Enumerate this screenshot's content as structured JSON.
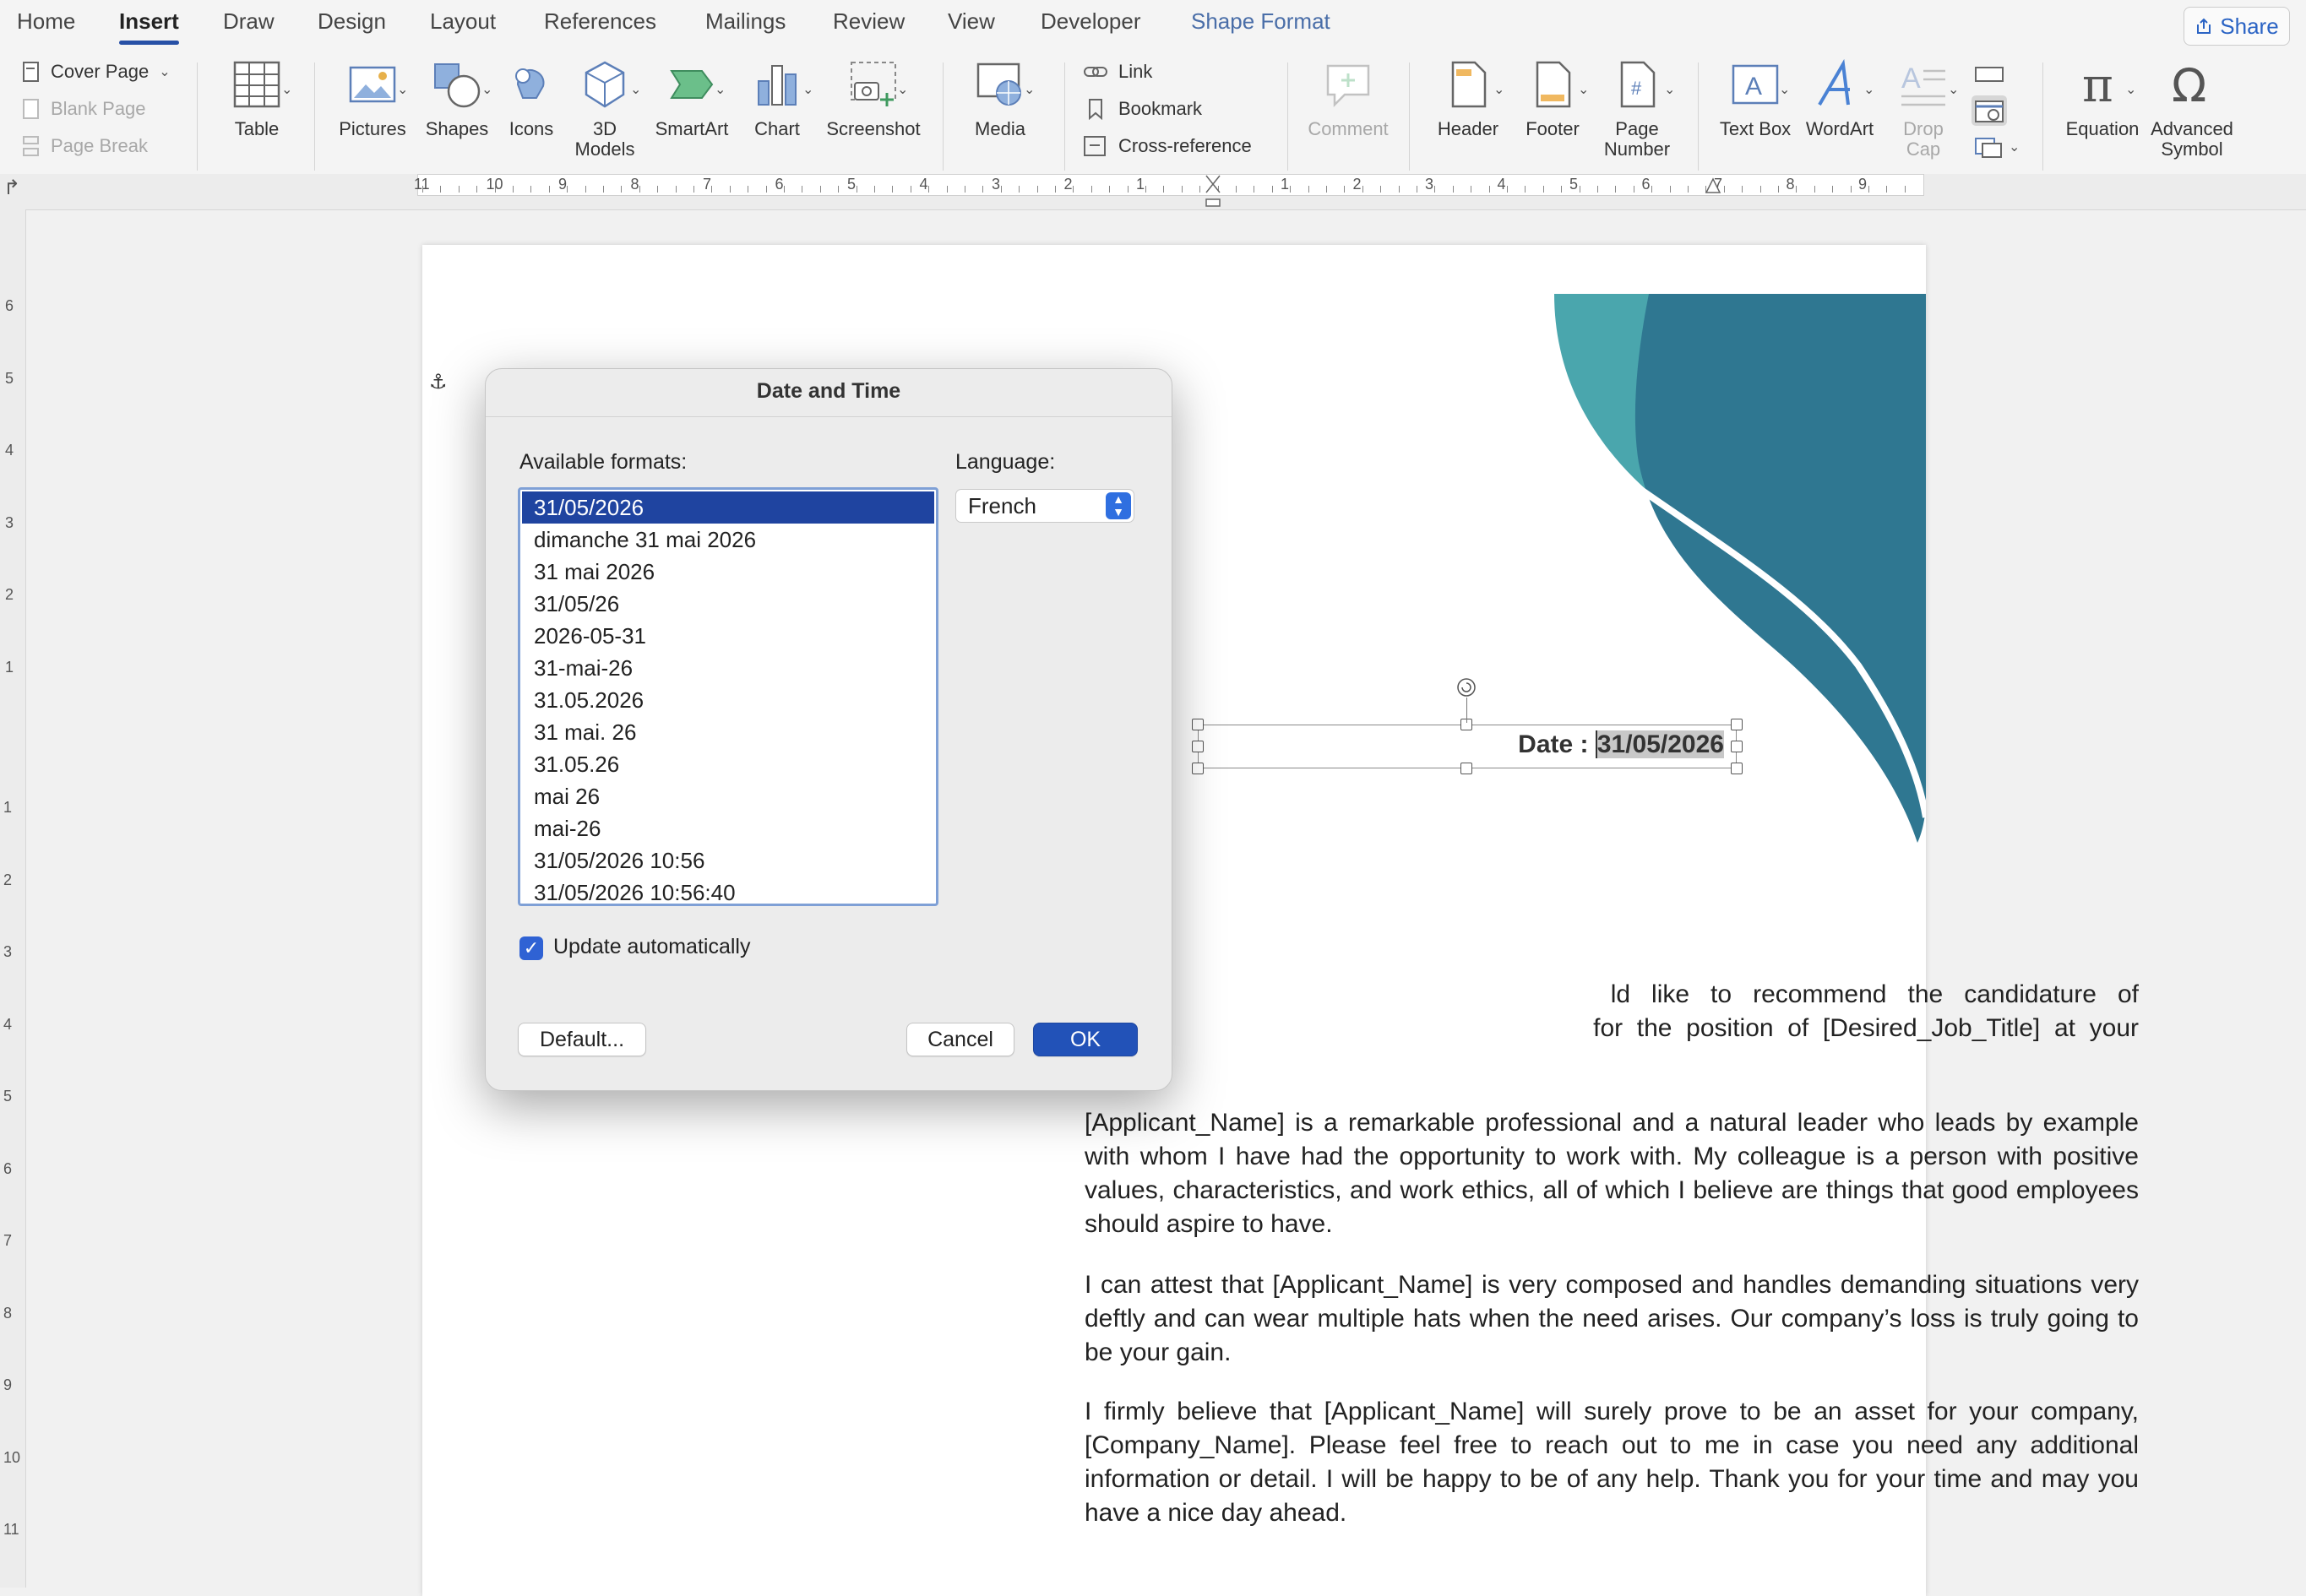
{
  "tabs": {
    "home": "Home",
    "insert": "Insert",
    "draw": "Draw",
    "design": "Design",
    "layout": "Layout",
    "references": "References",
    "mailings": "Mailings",
    "review": "Review",
    "view": "View",
    "developer": "Developer",
    "shape_format": "Shape Format"
  },
  "share_label": "Share",
  "ribbon": {
    "cover_page": "Cover Page",
    "blank_page": "Blank Page",
    "page_break": "Page Break",
    "table": "Table",
    "pictures": "Pictures",
    "shapes": "Shapes",
    "icons": "Icons",
    "models_3d_line1": "3D",
    "models_3d_line2": "Models",
    "smartart": "SmartArt",
    "chart": "Chart",
    "screenshot": "Screenshot",
    "media": "Media",
    "link": "Link",
    "bookmark": "Bookmark",
    "cross_reference": "Cross-reference",
    "comment": "Comment",
    "header": "Header",
    "footer": "Footer",
    "page_number_line1": "Page",
    "page_number_line2": "Number",
    "text_box": "Text Box",
    "wordart": "WordArt",
    "drop_cap_line1": "Drop",
    "drop_cap_line2": "Cap",
    "equation": "Equation",
    "advanced_symbol_line1": "Advanced",
    "advanced_symbol_line2": "Symbol"
  },
  "ruler": {
    "top_left": [
      "11",
      "10",
      "9",
      "8",
      "7",
      "6",
      "5",
      "4",
      "3",
      "2",
      "1"
    ],
    "top_right": [
      "1",
      "2",
      "3",
      "4",
      "5",
      "6",
      "7",
      "8",
      "9"
    ],
    "side_up": [
      "6",
      "5",
      "4",
      "3",
      "2",
      "1"
    ],
    "side_down": [
      "1",
      "2",
      "3",
      "4",
      "5",
      "6",
      "7",
      "8",
      "9",
      "10",
      "11"
    ]
  },
  "document": {
    "date_prefix": "Date : ",
    "date_value": "31/05/2026",
    "para1_line1": "ld   like   to   recommend   the   candidature   of",
    "para1_line2": "for  the  position  of  [Desired_Job_Title]  at  your",
    "para2": "[Applicant_Name] is a remarkable professional and a natural leader who leads by example with whom I have had the opportunity to work with. My colleague is a person with positive values, characteristics, and work ethics, all of which I believe are things that good employees should aspire to have.",
    "para3": "I can attest that [Applicant_Name] is very composed and handles demanding situations very deftly and can wear multiple hats when the need arises. Our company’s loss is truly going to be your gain.",
    "para4": "I firmly believe that [Applicant_Name] will surely prove to be an asset for your company, [Company_Name]. Please feel free to reach out to me in case you need any additional information or detail. I will be happy to be of any help. Thank you for your time and may you have a nice day ahead."
  },
  "dialog": {
    "title": "Date and Time",
    "formats_label": "Available formats:",
    "language_label": "Language:",
    "language_value": "French",
    "formats": [
      "31/05/2026",
      "dimanche 31 mai 2026",
      "31 mai 2026",
      "31/05/26",
      "2026-05-31",
      "31-mai-26",
      "31.05.2026",
      "31 mai. 26",
      "31.05.26",
      "mai 26",
      "mai-26",
      "31/05/2026 10:56",
      "31/05/2026 10:56:40"
    ],
    "selected_index": 0,
    "update_auto_label": "Update automatically",
    "update_auto_checked": true,
    "default_label": "Default...",
    "cancel_label": "Cancel",
    "ok_label": "OK"
  },
  "colors": {
    "accent": "#2750a6",
    "teal_light": "#4aa6ad",
    "teal_dark": "#2f7791",
    "selection": "#1f44a0"
  }
}
